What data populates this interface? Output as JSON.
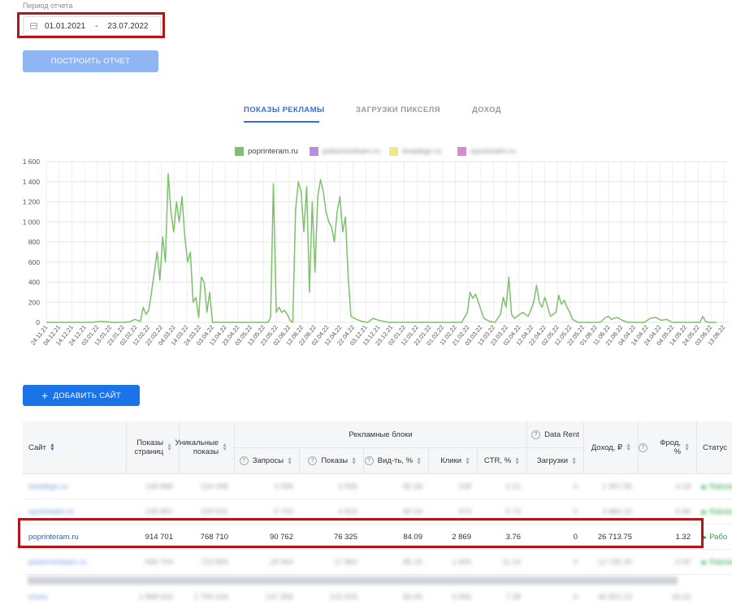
{
  "period": {
    "label": "Период отчета",
    "from": "01.01.2021",
    "separator": "-",
    "to": "23.07.2022"
  },
  "build_button": "ПОСТРОИТЬ ОТЧЕТ",
  "tabs": [
    {
      "label": "ПОКАЗЫ РЕКЛАМЫ",
      "active": true
    },
    {
      "label": "ЗАГРУЗКИ ПИКСЕЛЯ",
      "active": false
    },
    {
      "label": "ДОХОД",
      "active": false
    }
  ],
  "legend": [
    {
      "name": "poprinteram.ru",
      "color": "#7dc16a",
      "blurred": false
    },
    {
      "name": "pokemonlearn.ru",
      "color": "#b68ee0",
      "blurred": true
    },
    {
      "name": "treadegn.ru",
      "color": "#efe98b",
      "blurred": true
    },
    {
      "name": "sportrealm.ru",
      "color": "#d88ad2",
      "blurred": true
    }
  ],
  "chart_data": {
    "type": "line",
    "yticks": [
      "1 600",
      "1 400",
      "1 200",
      "1 000",
      "800",
      "600",
      "400",
      "200",
      "0"
    ],
    "ylim": [
      0,
      1600
    ],
    "xticks": [
      "24.11.21",
      "04.12.21",
      "14.12.21",
      "24.12.21",
      "03.01.22",
      "13.01.22",
      "23.01.22",
      "02.02.22",
      "12.02.22",
      "22.02.22",
      "04.03.22",
      "14.03.22",
      "24.03.22",
      "03.04.22",
      "13.04.22",
      "23.04.22",
      "03.05.22",
      "13.05.22",
      "23.05.22",
      "02.06.22",
      "12.06.22",
      "22.06.22",
      "02.04.22",
      "12.04.22",
      "22.04.22",
      "03.12.21",
      "13.12.21",
      "23.12.21",
      "02.01.22",
      "12.01.22",
      "22.01.22",
      "01.02.22",
      "11.02.22",
      "21.02.22",
      "03.03.22",
      "13.03.22",
      "23.03.22",
      "02.04.22",
      "12.04.22",
      "22.04.22",
      "02.05.22",
      "12.05.22",
      "22.05.22",
      "01.06.22",
      "11.06.22",
      "21.06.22",
      "04.04.22",
      "14.04.22",
      "24.04.22",
      "04.05.22",
      "14.05.22",
      "24.05.22",
      "03.06.22",
      "13.06.22"
    ],
    "series": [
      {
        "name": "poprinteram.ru",
        "color": "#7dc16a",
        "points": [
          [
            0,
            0
          ],
          [
            8,
            0
          ],
          [
            9,
            5
          ],
          [
            10,
            10
          ],
          [
            11,
            5
          ],
          [
            12,
            0
          ],
          [
            14,
            0
          ],
          [
            15,
            5
          ],
          [
            16,
            30
          ],
          [
            17,
            10
          ],
          [
            17.5,
            150
          ],
          [
            18,
            80
          ],
          [
            18.5,
            120
          ],
          [
            19,
            300
          ],
          [
            19.5,
            500
          ],
          [
            20,
            700
          ],
          [
            20.5,
            420
          ],
          [
            21,
            850
          ],
          [
            21.5,
            600
          ],
          [
            22,
            1480
          ],
          [
            22.5,
            1100
          ],
          [
            23,
            900
          ],
          [
            23.5,
            1200
          ],
          [
            24,
            1000
          ],
          [
            24.5,
            1250
          ],
          [
            25,
            850
          ],
          [
            25.5,
            600
          ],
          [
            26,
            700
          ],
          [
            26.5,
            200
          ],
          [
            27,
            250
          ],
          [
            27.5,
            50
          ],
          [
            28,
            450
          ],
          [
            28.5,
            400
          ],
          [
            29,
            100
          ],
          [
            29.5,
            300
          ],
          [
            30,
            0
          ],
          [
            40,
            0
          ],
          [
            40.5,
            50
          ],
          [
            41,
            1380
          ],
          [
            41.5,
            100
          ],
          [
            42,
            150
          ],
          [
            42.5,
            100
          ],
          [
            43,
            120
          ],
          [
            43.5,
            80
          ],
          [
            44,
            20
          ],
          [
            44.5,
            0
          ],
          [
            45,
            1120
          ],
          [
            45.5,
            1400
          ],
          [
            46,
            1300
          ],
          [
            46.5,
            900
          ],
          [
            47,
            1350
          ],
          [
            47.5,
            300
          ],
          [
            48,
            1200
          ],
          [
            48.5,
            500
          ],
          [
            49,
            1250
          ],
          [
            49.5,
            1420
          ],
          [
            50,
            1300
          ],
          [
            50.5,
            1100
          ],
          [
            51,
            1000
          ],
          [
            51.5,
            950
          ],
          [
            52,
            800
          ],
          [
            52.5,
            1100
          ],
          [
            53,
            1250
          ],
          [
            53.5,
            900
          ],
          [
            54,
            1050
          ],
          [
            54.5,
            450
          ],
          [
            55,
            60
          ],
          [
            56,
            30
          ],
          [
            57,
            10
          ],
          [
            58,
            0
          ],
          [
            59,
            40
          ],
          [
            60,
            20
          ],
          [
            61,
            10
          ],
          [
            62,
            0
          ],
          [
            75,
            0
          ],
          [
            76,
            100
          ],
          [
            76.5,
            300
          ],
          [
            77,
            240
          ],
          [
            77.5,
            280
          ],
          [
            78,
            200
          ],
          [
            78.5,
            120
          ],
          [
            79,
            40
          ],
          [
            80,
            10
          ],
          [
            81,
            0
          ],
          [
            82,
            80
          ],
          [
            82.5,
            250
          ],
          [
            83,
            150
          ],
          [
            83.5,
            450
          ],
          [
            84,
            80
          ],
          [
            84.5,
            40
          ],
          [
            85,
            60
          ],
          [
            86,
            100
          ],
          [
            87,
            60
          ],
          [
            88,
            200
          ],
          [
            88.5,
            370
          ],
          [
            89,
            200
          ],
          [
            89.5,
            150
          ],
          [
            90,
            250
          ],
          [
            91,
            60
          ],
          [
            92,
            100
          ],
          [
            92.5,
            270
          ],
          [
            93,
            180
          ],
          [
            93.5,
            220
          ],
          [
            94,
            150
          ],
          [
            94.5,
            100
          ],
          [
            95,
            30
          ],
          [
            96,
            0
          ],
          [
            100,
            0
          ],
          [
            101,
            50
          ],
          [
            101.5,
            60
          ],
          [
            102,
            30
          ],
          [
            103,
            50
          ],
          [
            104,
            20
          ],
          [
            105,
            0
          ],
          [
            108,
            0
          ],
          [
            109,
            40
          ],
          [
            110,
            50
          ],
          [
            111,
            20
          ],
          [
            112,
            30
          ],
          [
            113,
            0
          ],
          [
            118,
            0
          ],
          [
            118.5,
            60
          ],
          [
            119,
            10
          ],
          [
            119.5,
            0
          ],
          [
            121,
            0
          ]
        ]
      }
    ]
  },
  "add_site_button": "ДОБАВИТЬ САЙТ",
  "table": {
    "headers": {
      "site": "Сайт",
      "page_views": "Показы страниц",
      "unique_views": "Уникальные показы",
      "ad_blocks": "Рекламные блоки",
      "requests": "Запросы",
      "impressions": "Показы",
      "viewability": "Вид-ть, %",
      "clicks": "Клики",
      "ctr": "CTR, %",
      "data_rent": "Data Rent",
      "loads": "Загрузки",
      "income": "Доход, ₽",
      "fraud": "Фрод, %",
      "status": "Статус"
    },
    "rows": [
      {
        "site": "treadegn.ru",
        "page_views": "149 886",
        "unique_views": "124 096",
        "requests": "4 096",
        "impressions": "3 936",
        "viewability": "82.39",
        "clicks": "108",
        "ctr": "2.22",
        "loads": "0",
        "income": "1 957.95",
        "fraud": "4.18",
        "status": "Rabota",
        "blurred": true
      },
      {
        "site": "sportrealm.ru",
        "page_views": "136 897",
        "unique_views": "109 531",
        "requests": "5 700",
        "impressions": "4 824",
        "viewability": "80.34",
        "clicks": "374",
        "ctr": "5.73",
        "loads": "0",
        "income": "3 880.10",
        "fraud": "0.96",
        "status": "Rabota",
        "blurred": true
      },
      {
        "site": "poprinteram.ru",
        "page_views": "914 701",
        "unique_views": "768 710",
        "requests": "90 762",
        "impressions": "76 325",
        "viewability": "84.09",
        "clicks": "2 869",
        "ctr": "3.76",
        "loads": "0",
        "income": "26 713.75",
        "fraud": "1.32",
        "status": "Рабо",
        "blurred": false
      },
      {
        "site": "pokemonlearn.ru",
        "page_views": "566 704",
        "unique_views": "723 800",
        "requests": "18 964",
        "impressions": "17 860",
        "viewability": "85.15",
        "clicks": "1 600",
        "ctr": "11.16",
        "loads": "0",
        "income": "13 735.30",
        "fraud": "0.00",
        "status": "Rabota",
        "blurred": true
      },
      {
        "site": "итого",
        "page_views": "1 868 640",
        "unique_views": "1 755 534",
        "requests": "137 956",
        "impressions": "122 605",
        "viewability": "83.45",
        "clicks": "5 556",
        "ctr": "7.38",
        "loads": "0",
        "income": "46 822.23",
        "fraud": "18.22",
        "status": "",
        "blurred": true
      }
    ]
  }
}
